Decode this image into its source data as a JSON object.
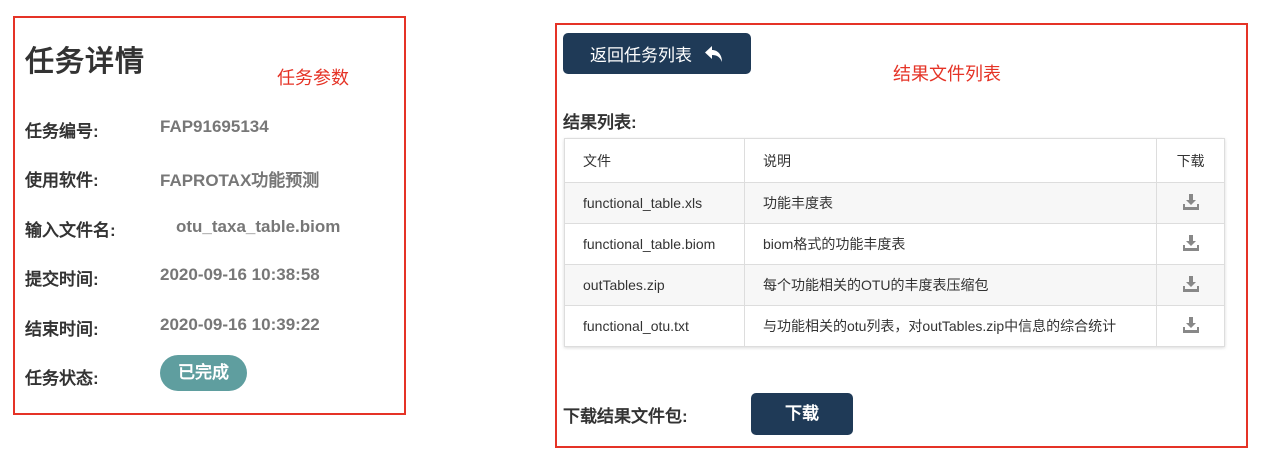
{
  "task_details": {
    "title": "任务详情",
    "annotation": "任务参数",
    "rows": [
      {
        "label": "任务编号:",
        "value": "FAP91695134"
      },
      {
        "label": "使用软件:",
        "value": "FAPROTAX功能预测"
      },
      {
        "label": "输入文件名:",
        "value": "otu_taxa_table.biom"
      },
      {
        "label": "提交时间:",
        "value": "2020-09-16 10:38:58"
      },
      {
        "label": "结束时间:",
        "value": "2020-09-16 10:39:22"
      }
    ],
    "status_label": "任务状态:",
    "status_value": "已完成",
    "status_color": "#5f9e9f"
  },
  "results": {
    "back_button_label": "返回任务列表",
    "back_icon": "reply-arrow-icon",
    "annotation": "结果文件列表",
    "list_label": "结果列表:",
    "columns": [
      "文件",
      "说明",
      "下载"
    ],
    "rows": [
      {
        "file": "functional_table.xls",
        "description": "功能丰度表",
        "download_icon": "download-icon"
      },
      {
        "file": "functional_table.biom",
        "description": "biom格式的功能丰度表",
        "download_icon": "download-icon"
      },
      {
        "file": "outTables.zip",
        "description": "每个功能相关的OTU的丰度表压缩包",
        "download_icon": "download-icon"
      },
      {
        "file": "functional_otu.txt",
        "description": "与功能相关的otu列表，对outTables.zip中信息的综合统计",
        "download_icon": "download-icon"
      }
    ],
    "package_label": "下载结果文件包:",
    "package_button_label": "下载"
  },
  "colors": {
    "annotation_red": "#e53326",
    "button_navy": "#1f3a57",
    "status_teal": "#5f9e9f"
  }
}
